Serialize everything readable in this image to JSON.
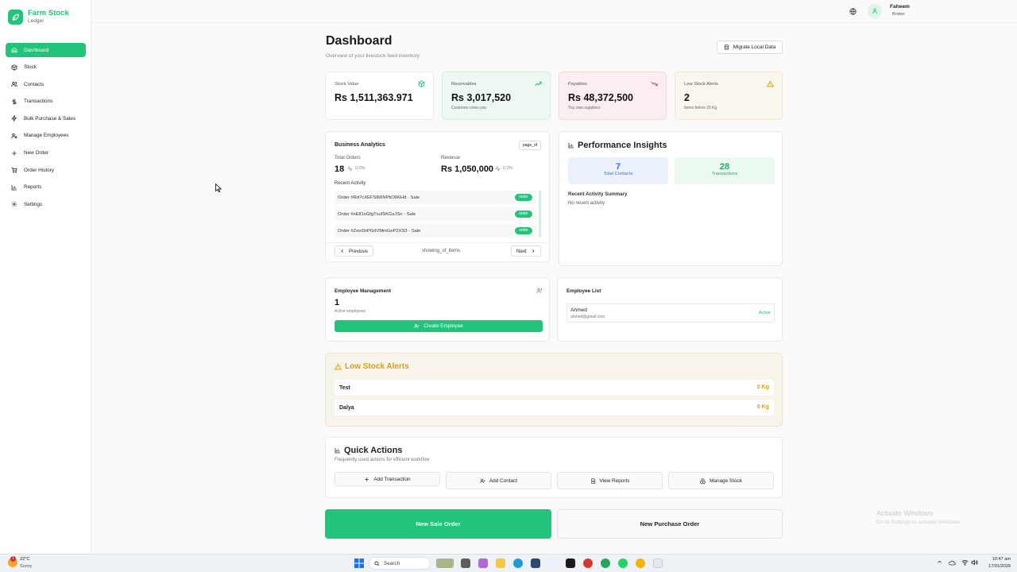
{
  "app": {
    "name": "Farm Stock",
    "subtitle": "Ledger"
  },
  "sidebar": {
    "items": [
      {
        "label": "Dashboard",
        "icon": "home-icon",
        "active": true
      },
      {
        "label": "Stock",
        "icon": "box-icon"
      },
      {
        "label": "Contacts",
        "icon": "users-icon"
      },
      {
        "label": "Transactions",
        "icon": "dollar-icon"
      },
      {
        "label": "Bulk Purchase & Sales",
        "icon": "zap-icon"
      },
      {
        "label": "Manage Employees",
        "icon": "user-cog-icon"
      },
      {
        "label": "New Order",
        "icon": "plus-icon"
      },
      {
        "label": "Order History",
        "icon": "cart-icon"
      },
      {
        "label": "Reports",
        "icon": "bar-chart-icon"
      },
      {
        "label": "Settings",
        "icon": "gear-icon"
      }
    ]
  },
  "header": {
    "user_name": "Faheem",
    "user_role": "Broker"
  },
  "page": {
    "title": "Dashboard",
    "subtitle": "Overview of your livestock feed inventory",
    "migrate_label": "Migrate Local Data"
  },
  "stats": [
    {
      "label": "Stock Value",
      "value": "Rs 1,511,363.971",
      "sub": "",
      "icon": "package-icon",
      "color": "#22c37a"
    },
    {
      "label": "Receivables",
      "value": "Rs 3,017,520",
      "sub": "Customer owes you",
      "icon": "trending-up-icon",
      "color": "#22c37a"
    },
    {
      "label": "Payables",
      "value": "Rs 48,372,500",
      "sub": "You owe suppliers",
      "icon": "trending-down-icon",
      "color": "#e5484d"
    },
    {
      "label": "Low Stock Alerts",
      "value": "2",
      "sub": "Items below 20 Kg",
      "icon": "warning-icon",
      "color": "#e0a000"
    }
  ],
  "analytics": {
    "title": "Business Analytics",
    "badge": "page_of",
    "total_orders_label": "Total Orders",
    "total_orders": "18",
    "total_orders_change": "0.0%",
    "revenue_label": "Revenue",
    "revenue": "Rs 1,050,000",
    "revenue_change": "0.0%",
    "recent_activity_label": "Recent Activity",
    "orders": [
      {
        "text": "Order #Rd7cXEFSt66NPtiO6KHd - Sale",
        "badge": "order"
      },
      {
        "text": "Order #xE81xGfgTvufSKGzJSn - Sale",
        "badge": "order"
      },
      {
        "text": "Order #Zevi0nPGiIVMmGeP2XS3 - Sale",
        "badge": "order"
      }
    ],
    "prev_label": "Previous",
    "showing_label": "showing_of_items",
    "next_label": "Next"
  },
  "performance": {
    "title": "Performance Insights",
    "contacts_value": "7",
    "contacts_label": "Total Contacts",
    "transactions_value": "28",
    "transactions_label": "Transactions",
    "summary_title": "Recent Activity Summary",
    "summary_text": "No recent activity"
  },
  "employees": {
    "title": "Employee Management",
    "count": "1",
    "count_label": "Active employees",
    "create_label": "Create Employee",
    "list_title": "Employee List",
    "list": [
      {
        "name": "Ahmed",
        "email": "ahmed@gmail.com",
        "status": "Active"
      }
    ]
  },
  "low_stock": {
    "title": "Low Stock Alerts",
    "items": [
      {
        "name": "Test",
        "qty": "0 Kg"
      },
      {
        "name": "Dalya",
        "qty": "0 Kg"
      }
    ]
  },
  "quick_actions": {
    "title": "Quick Actions",
    "subtitle": "Frequently used actions for efficient workflow",
    "buttons": [
      {
        "label": "Add Transaction",
        "icon": "plus-icon"
      },
      {
        "label": "Add Contact",
        "icon": "user-plus-icon"
      },
      {
        "label": "View Reports",
        "icon": "document-icon"
      },
      {
        "label": "Manage Stock",
        "icon": "boxes-icon"
      }
    ]
  },
  "bottom": {
    "new_sale": "New Sale Order",
    "new_purchase": "New Purchase Order"
  },
  "watermark": {
    "line1": "Activate Windows",
    "line2": "Go to Settings to activate Windows."
  },
  "taskbar": {
    "weather_temp": "22°C",
    "weather_desc": "Sunny",
    "search_placeholder": "Search",
    "time": "10:47 am",
    "date": "17/01/2026"
  },
  "colors": {
    "accent": "#22c37a",
    "danger": "#e5484d",
    "warning": "#e0a000",
    "info": "#3b6fd8"
  }
}
